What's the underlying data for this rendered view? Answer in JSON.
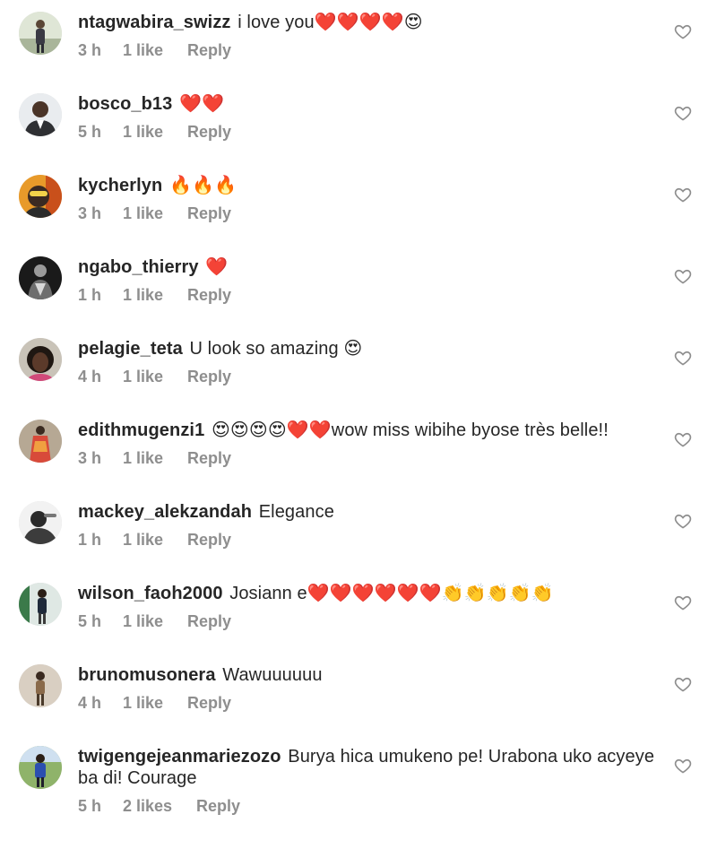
{
  "colors": {
    "text": "#262626",
    "meta": "#8e8e8e",
    "heart_outline": "#8e8e8e"
  },
  "comments": [
    {
      "username": "ntagwabira_swizz",
      "text": "i love you❤️❤️❤️❤️😍",
      "time": "3 h",
      "likes": "1 like",
      "reply": "Reply",
      "avatar_icon": "avatar-photo-icon"
    },
    {
      "username": "bosco_b13",
      "text": "❤️❤️",
      "time": "5 h",
      "likes": "1 like",
      "reply": "Reply",
      "avatar_icon": "avatar-photo-icon"
    },
    {
      "username": "kycherlyn",
      "text": "🔥🔥🔥",
      "time": "3 h",
      "likes": "1 like",
      "reply": "Reply",
      "avatar_icon": "avatar-photo-icon"
    },
    {
      "username": "ngabo_thierry",
      "text": "❤️",
      "time": "1 h",
      "likes": "1 like",
      "reply": "Reply",
      "avatar_icon": "avatar-photo-icon"
    },
    {
      "username": "pelagie_teta",
      "text": "U look so amazing 😍",
      "time": "4 h",
      "likes": "1 like",
      "reply": "Reply",
      "avatar_icon": "avatar-photo-icon"
    },
    {
      "username": "edithmugenzi1",
      "text": "😍😍😍😍❤️❤️wow miss wibihe byose très belle!!",
      "time": "3 h",
      "likes": "1 like",
      "reply": "Reply",
      "avatar_icon": "avatar-photo-icon"
    },
    {
      "username": "mackey_alekzandah",
      "text": "Elegance",
      "time": "1 h",
      "likes": "1 like",
      "reply": "Reply",
      "avatar_icon": "avatar-photo-icon"
    },
    {
      "username": "wilson_faoh2000",
      "text": "Josiann e❤️❤️❤️❤️❤️❤️👏👏👏👏👏",
      "time": "5 h",
      "likes": "1 like",
      "reply": "Reply",
      "avatar_icon": "avatar-photo-icon"
    },
    {
      "username": "brunomusonera",
      "text": "Wawuuuuuu",
      "time": "4 h",
      "likes": "1 like",
      "reply": "Reply",
      "avatar_icon": "avatar-photo-icon"
    },
    {
      "username": "twigengejeanmariezozo",
      "text": "Burya hica umukeno pe! Urabona uko acyeye ba di! Courage",
      "time": "5 h",
      "likes": "2 likes",
      "reply": "Reply",
      "avatar_icon": "avatar-photo-icon"
    }
  ]
}
